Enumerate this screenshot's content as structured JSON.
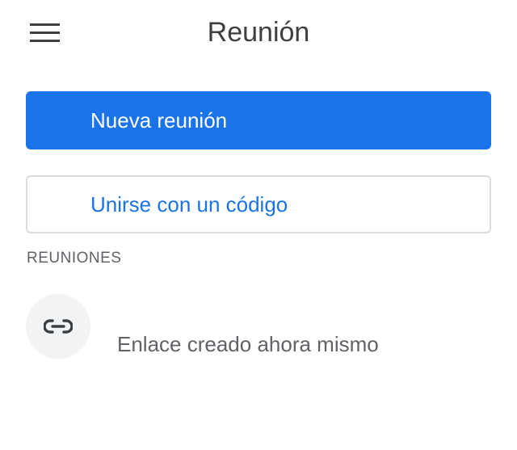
{
  "header": {
    "title": "Reunión",
    "menu_icon": "hamburger-menu-icon"
  },
  "actions": {
    "new_meeting_label": "Nueva reunión",
    "join_with_code_label": "Unirse con un código"
  },
  "meetings": {
    "section_title": "REUNIONES",
    "items": [
      {
        "icon": "link-icon",
        "label": "Enlace creado ahora mismo"
      }
    ]
  },
  "colors": {
    "accent": "#1a73e8",
    "text_primary": "#3c4043",
    "text_secondary": "#5f6368",
    "border": "#dadce0",
    "avatar_bg": "#f1f3f4"
  }
}
